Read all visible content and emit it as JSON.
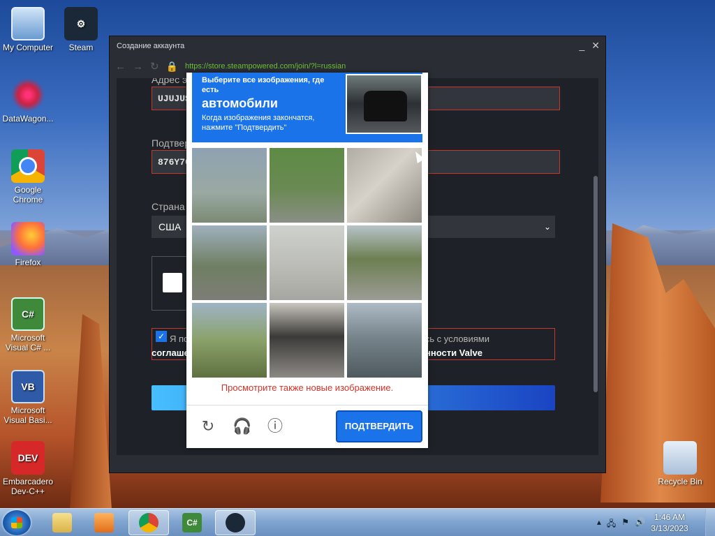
{
  "desktop": {
    "icons": [
      {
        "label": "My Computer"
      },
      {
        "label": "Steam"
      },
      {
        "label": "DataWagon..."
      },
      {
        "label": "Google Chrome"
      },
      {
        "label": "Firefox"
      },
      {
        "label": "Microsoft Visual C# ..."
      },
      {
        "label": "Microsoft Visual Basi..."
      },
      {
        "label": "Embarcadero Dev-C++"
      },
      {
        "label": "Recycle Bin"
      }
    ]
  },
  "window": {
    "title": "Создание аккаунта",
    "url": "https://store.steampowered.com/join/?l=russian",
    "form": {
      "email_label": "Адрес э",
      "email_value": "UJUJUS",
      "confirm_label": "Подтвер",
      "confirm_value": "876Y76",
      "country_label": "Страна",
      "country_value": "США",
      "agree_text_left": "Я по",
      "agree_text_right": "юсь с условиями",
      "agree_bold_left": "соглаше",
      "agree_bold_right": "нности Valve",
      "agree_period": "."
    }
  },
  "captcha": {
    "instruction_line1": "Выберите все изображения, где есть",
    "target": "автомобили",
    "instruction_line2": "Когда изображения закончатся, нажмите \"Подтвердить\"",
    "error": "Просмотрите также новые изображение.",
    "confirm_button": "ПОДТВЕРДИТЬ",
    "icons": [
      "refresh-icon",
      "headphones-icon",
      "info-icon"
    ]
  },
  "taskbar": {
    "time": "1:46 AM",
    "date": "3/13/2023"
  }
}
